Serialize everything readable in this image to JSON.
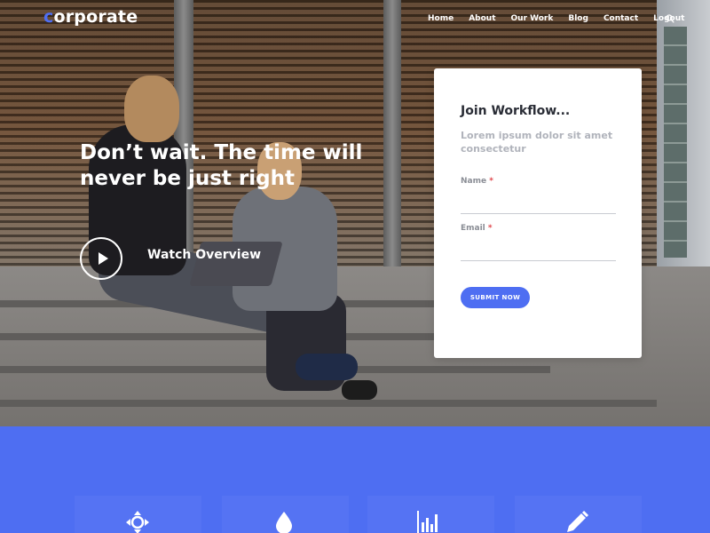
{
  "brand": {
    "logo_first": "c",
    "logo_rest": "orporate",
    "accent": "#4e6ef2"
  },
  "nav": {
    "items": [
      "Home",
      "About",
      "Our Work",
      "Blog",
      "Contact",
      "Logout"
    ],
    "search_icon": "search-icon"
  },
  "hero": {
    "headline": "Don’t wait. The time will never be just right",
    "watch_label": "Watch Overview",
    "play_icon": "play-icon"
  },
  "form": {
    "title": "Join Workflow...",
    "subtitle": "Lorem ipsum dolor sit amet consectetur",
    "name_label": "Name",
    "email_label": "Email",
    "required_mark": "*",
    "name_value": "",
    "email_value": "",
    "submit_label": "SUBMIT NOW"
  },
  "features": {
    "icons": [
      "move-icon",
      "drop-icon",
      "bar-chart-icon",
      "pencil-icon"
    ]
  }
}
